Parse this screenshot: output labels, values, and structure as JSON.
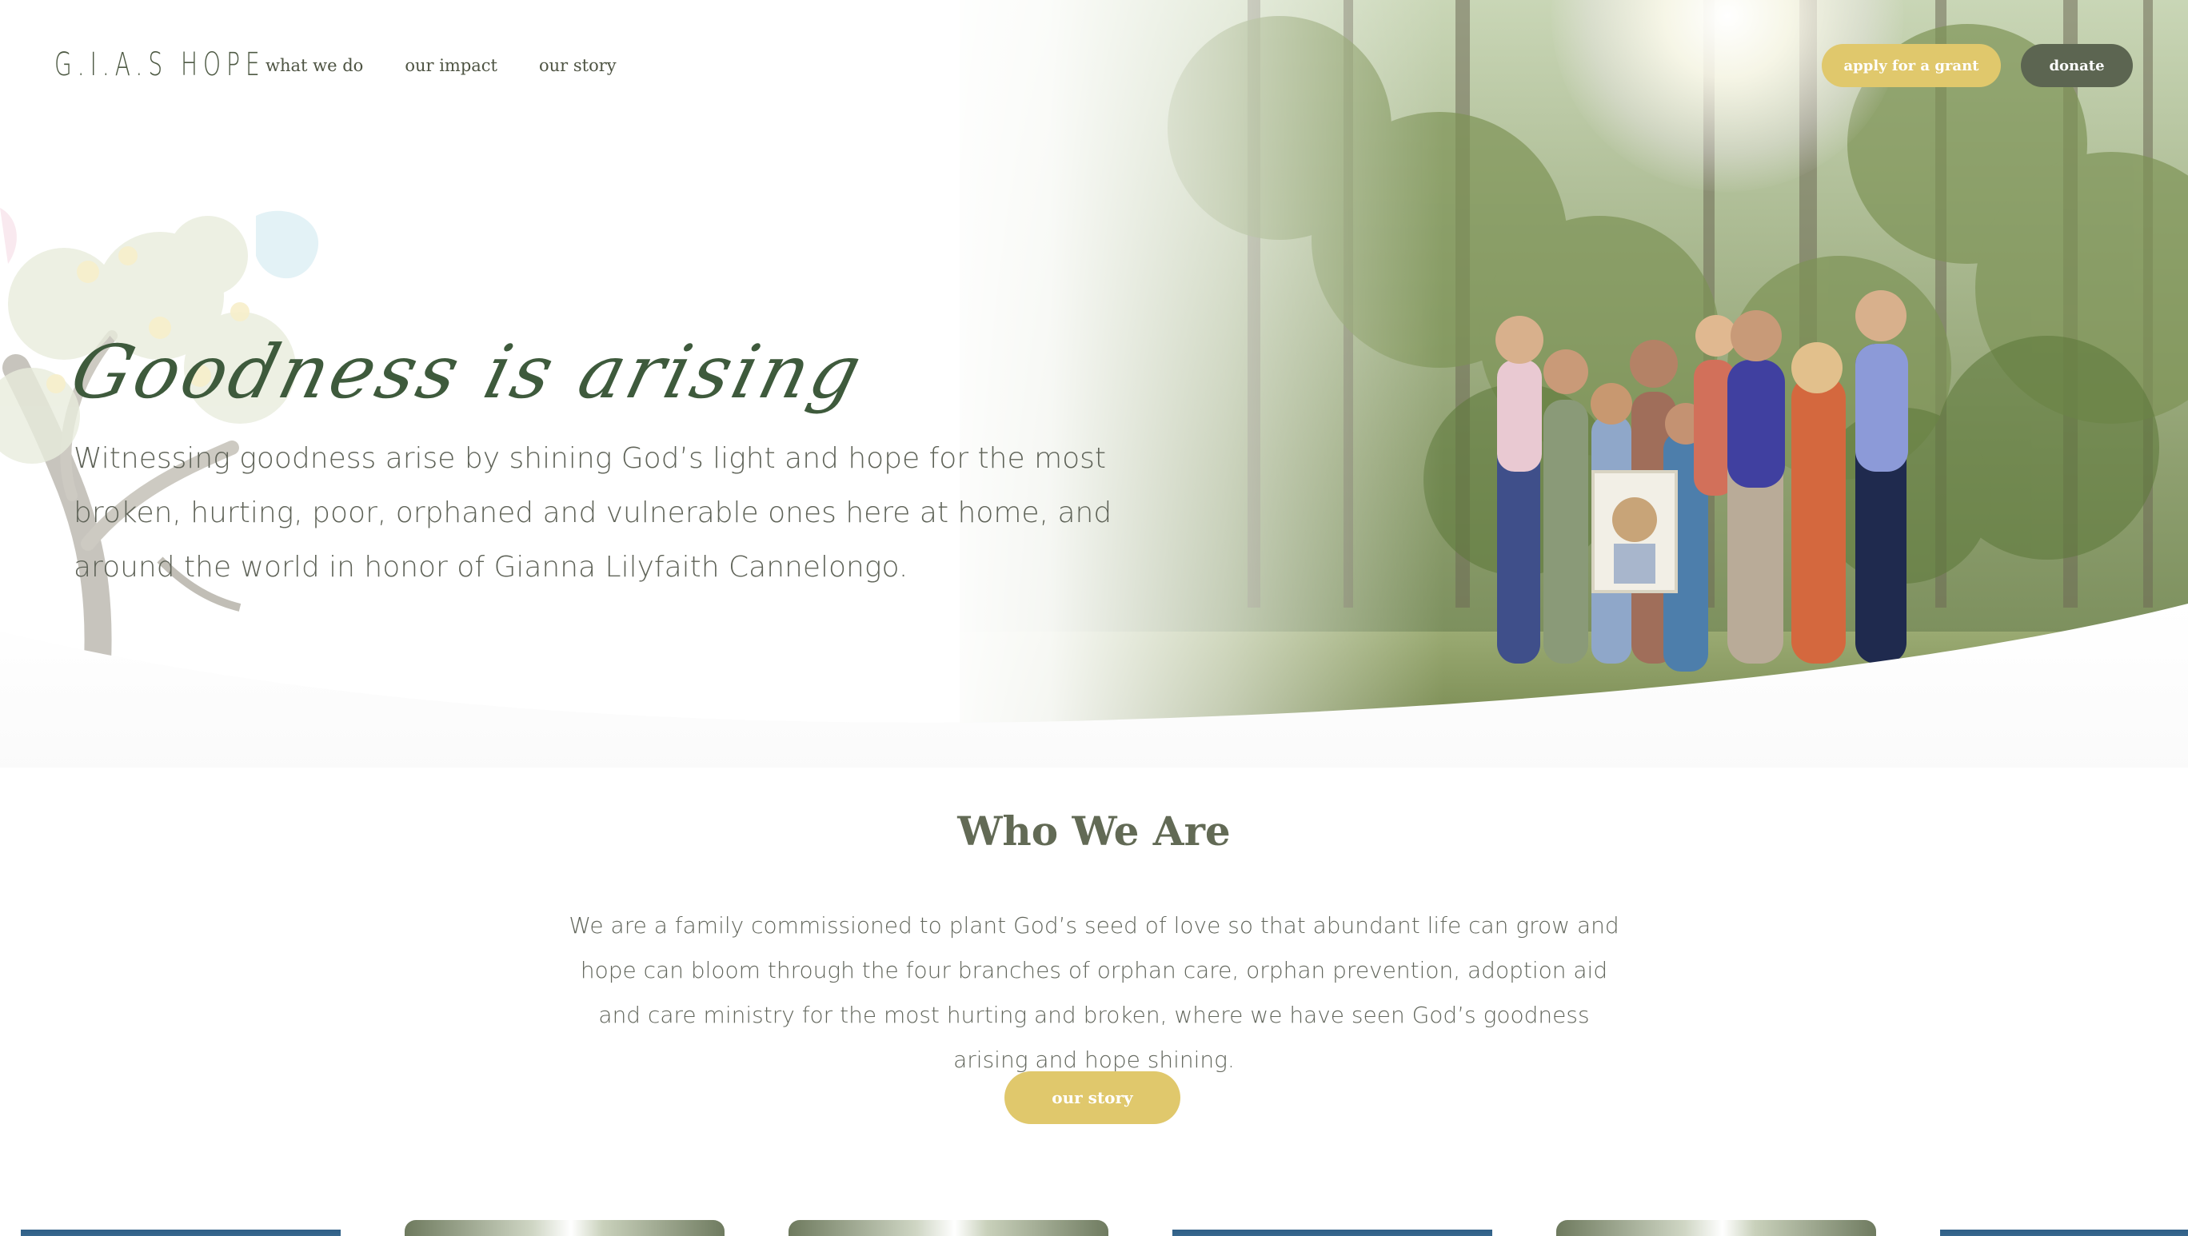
{
  "header": {
    "logo": "G.I.A.S HOPE",
    "nav": [
      "what we do",
      "our impact",
      "our story"
    ],
    "apply_button": "apply for a grant",
    "donate_button": "donate"
  },
  "hero": {
    "title": "Goodness is arising",
    "body": "Witnessing goodness arise by shining God’s light and hope for the most broken, hurting, poor, orphaned and vulnerable ones here at home, and around the world in honor of Gianna Lilyfaith Cannelongo."
  },
  "who_we_are": {
    "title": "Who We Are",
    "body": "We are a family commissioned to plant God’s seed of love so that abundant life can grow and hope can bloom through the four branches of orphan care, orphan prevention, adoption aid and care ministry for the most hurting and broken, where we have seen God’s goodness arising and hope shining.",
    "button": "our story"
  },
  "colors": {
    "accent": "#e0c86c",
    "dark_green": "#5c6551",
    "title_green": "#3e5a3c"
  }
}
